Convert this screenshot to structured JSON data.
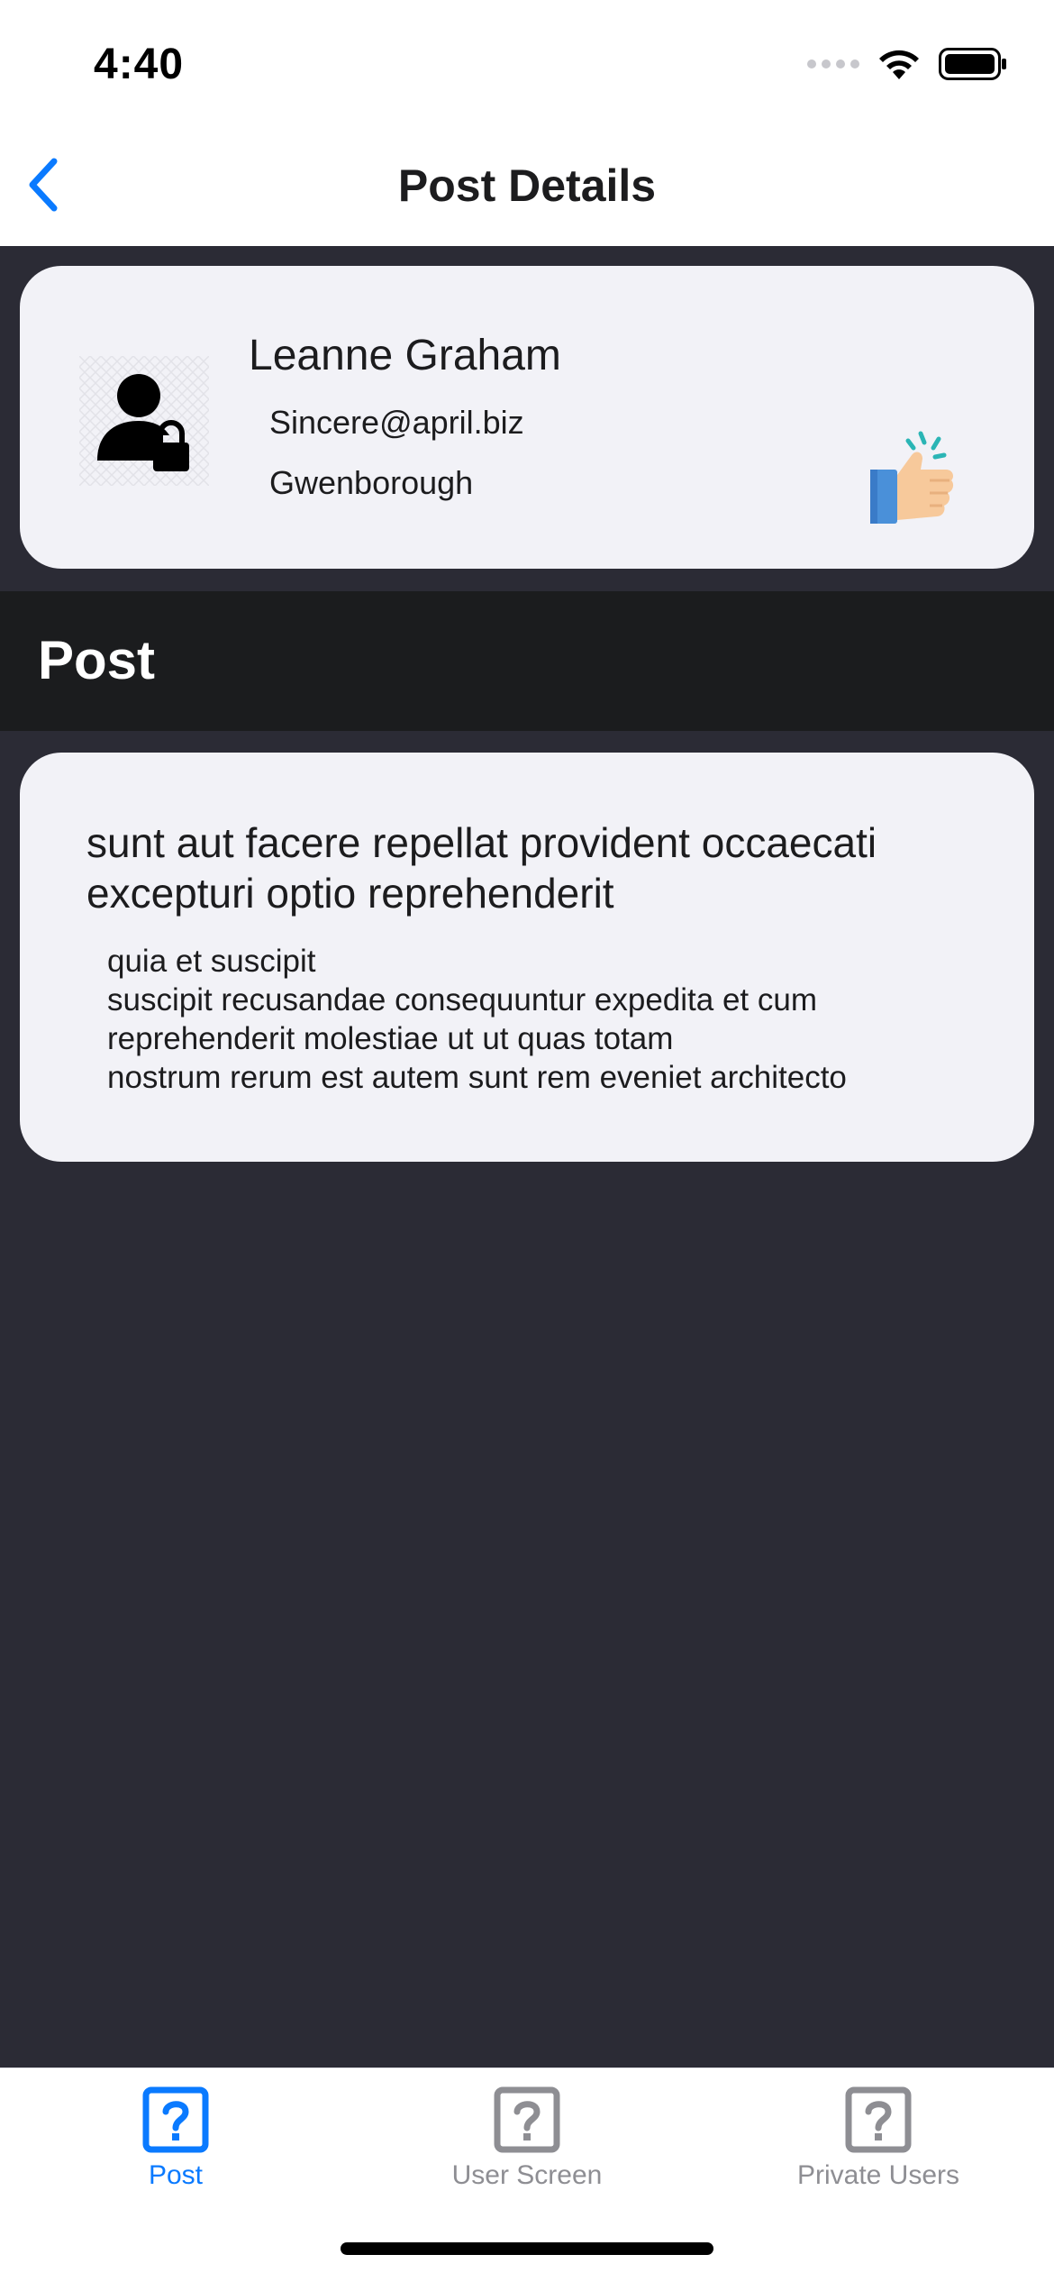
{
  "status_bar": {
    "time": "4:40"
  },
  "nav": {
    "title": "Post Details"
  },
  "user": {
    "name": "Leanne Graham",
    "email": "Sincere@april.biz",
    "city": "Gwenborough"
  },
  "section": {
    "title": "Post"
  },
  "post": {
    "title": "sunt aut facere repellat provident occaecati excepturi optio reprehenderit",
    "body": "quia et suscipit\nsuscipit recusandae consequuntur expedita et cum\nreprehenderit molestiae ut ut quas totam\nnostrum rerum est autem sunt rem eveniet architecto"
  },
  "tabs": [
    {
      "label": "Post",
      "icon": "question-square-icon",
      "active": true
    },
    {
      "label": "User Screen",
      "icon": "question-square-icon",
      "active": false
    },
    {
      "label": "Private Users",
      "icon": "question-square-icon",
      "active": false
    }
  ],
  "colors": {
    "accent": "#0a7aff",
    "inactive": "#8e8e93",
    "background": "#2b2b35",
    "card": "#f2f2f7",
    "section_header": "#1b1c1e"
  }
}
